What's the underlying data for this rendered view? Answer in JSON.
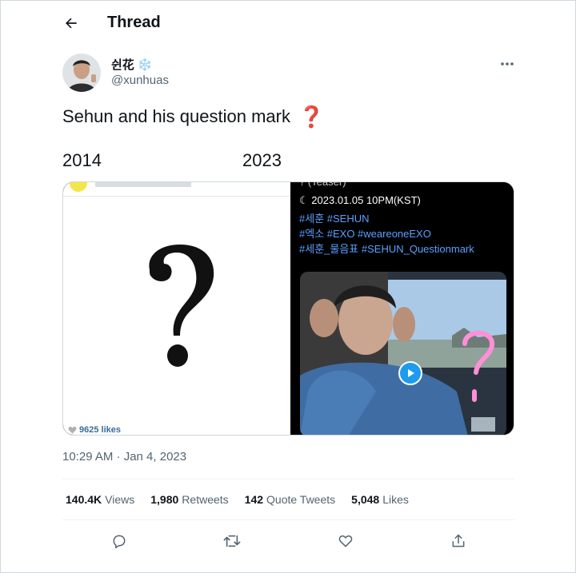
{
  "header": {
    "title": "Thread",
    "back_icon": "arrow-left-icon"
  },
  "author": {
    "display_name": "쉰花",
    "emoji": "❄️",
    "handle": "@xunhuas"
  },
  "tweet": {
    "text": "Sehun and his question mark",
    "emoji": "❓",
    "year_left": "2014",
    "year_right": "2023"
  },
  "media": {
    "left": {
      "likes": "9625 likes"
    },
    "right": {
      "teaser": "? (Teaser)",
      "date_line": "2023.01.05 10PM(KST)",
      "tags_1": "#세훈 #SEHUN",
      "tags_2": "#엑소 #EXO #weareoneEXO",
      "tags_3": "#세훈_물음표 #SEHUN_Questionmark"
    }
  },
  "timestamp": "10:29 AM · Jan 4, 2023",
  "stats": [
    {
      "value": "140.4K",
      "label": "Views"
    },
    {
      "value": "1,980",
      "label": "Retweets"
    },
    {
      "value": "142",
      "label": "Quote Tweets"
    },
    {
      "value": "5,048",
      "label": "Likes"
    }
  ],
  "colors": {
    "accent": "#1d9bf0",
    "secondary_text": "#536471",
    "hashtag": "#5aa0ff",
    "question_emoji": "#d32f2f"
  }
}
